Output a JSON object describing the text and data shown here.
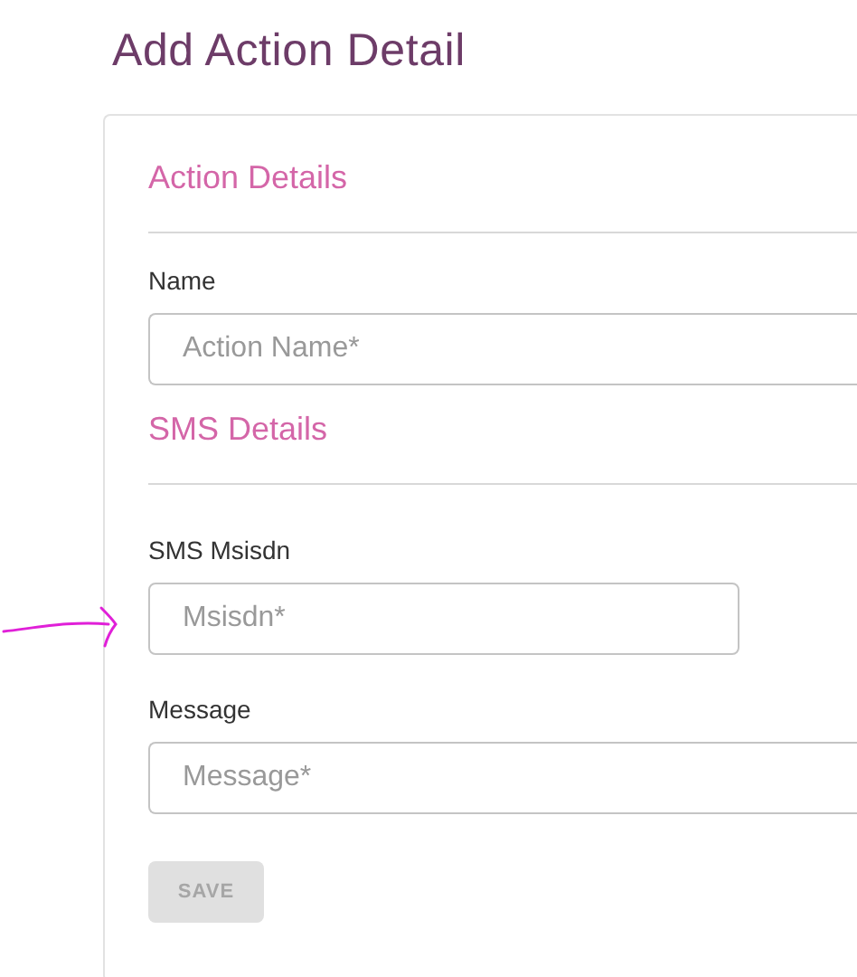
{
  "page_title": "Add Action Detail",
  "sections": [
    {
      "heading": "Action Details",
      "fields": [
        {
          "label": "Name",
          "placeholder": "Action Name*",
          "kind": "wide"
        }
      ]
    },
    {
      "heading": "SMS Details",
      "fields": [
        {
          "label": "SMS Msisdn",
          "placeholder": "Msisdn*",
          "kind": "narrow"
        },
        {
          "label": "Message",
          "placeholder": "Message*",
          "kind": "wide"
        }
      ]
    }
  ],
  "save_button": {
    "label": "SAVE",
    "disabled": true
  }
}
